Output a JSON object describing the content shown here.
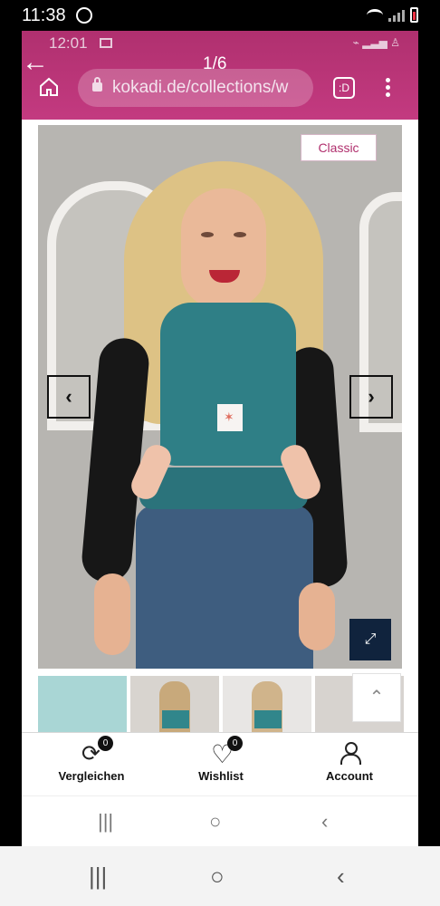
{
  "outer_status": {
    "time": "11:38"
  },
  "inner_status": {
    "time": "12:01"
  },
  "browser": {
    "url": "kokadi.de/collections/w",
    "pager": "1/6",
    "tabs_label": ":D"
  },
  "product": {
    "badge": "Classic",
    "prev": "‹",
    "next": "›",
    "zoom": "⤢"
  },
  "scroll_top": "⌃",
  "bottom_nav": {
    "compare_label": "Vergleichen",
    "compare_count": "0",
    "wishlist_label": "Wishlist",
    "wishlist_count": "0",
    "account_label": "Account"
  },
  "system_nav": {
    "recent": "|||",
    "home": "○",
    "back": "‹"
  },
  "colors": {
    "browser_bar": "#c33a80",
    "accent": "#b02f6d",
    "carrier": "#2f7f86",
    "zoom_button": "#10233d"
  }
}
